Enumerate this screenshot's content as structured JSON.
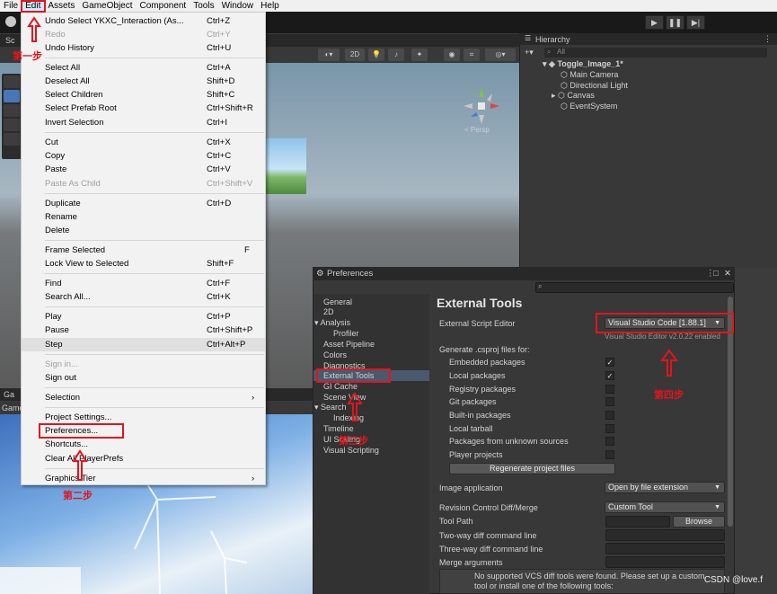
{
  "menubar": {
    "items": [
      "File",
      "Edit",
      "Assets",
      "GameObject",
      "Component",
      "Tools",
      "Window",
      "Help"
    ]
  },
  "edit_menu": {
    "items": [
      {
        "label": "Undo Select YKXC_Interaction (As...",
        "shortcut": "Ctrl+Z"
      },
      {
        "label": "Redo",
        "shortcut": "Ctrl+Y",
        "disabled": true
      },
      {
        "label": "Undo History",
        "shortcut": "Ctrl+U"
      },
      {
        "label": "Select All",
        "shortcut": "Ctrl+A"
      },
      {
        "label": "Deselect All",
        "shortcut": "Shift+D"
      },
      {
        "label": "Select Children",
        "shortcut": "Shift+C"
      },
      {
        "label": "Select Prefab Root",
        "shortcut": "Ctrl+Shift+R"
      },
      {
        "label": "Invert Selection",
        "shortcut": "Ctrl+I"
      },
      {
        "label": "Cut",
        "shortcut": "Ctrl+X"
      },
      {
        "label": "Copy",
        "shortcut": "Ctrl+C"
      },
      {
        "label": "Paste",
        "shortcut": "Ctrl+V"
      },
      {
        "label": "Paste As Child",
        "shortcut": "Ctrl+Shift+V",
        "disabled": true
      },
      {
        "label": "Duplicate",
        "shortcut": "Ctrl+D"
      },
      {
        "label": "Rename",
        "shortcut": ""
      },
      {
        "label": "Delete",
        "shortcut": ""
      },
      {
        "label": "Frame Selected",
        "shortcut": "F"
      },
      {
        "label": "Lock View to Selected",
        "shortcut": "Shift+F"
      },
      {
        "label": "Find",
        "shortcut": "Ctrl+F"
      },
      {
        "label": "Search All...",
        "shortcut": "Ctrl+K"
      },
      {
        "label": "Play",
        "shortcut": "Ctrl+P"
      },
      {
        "label": "Pause",
        "shortcut": "Ctrl+Shift+P"
      },
      {
        "label": "Step",
        "shortcut": "Ctrl+Alt+P"
      },
      {
        "label": "Sign in...",
        "shortcut": "",
        "disabled": true
      },
      {
        "label": "Sign out",
        "shortcut": ""
      },
      {
        "label": "Selection",
        "shortcut": "›"
      },
      {
        "label": "Project Settings...",
        "shortcut": ""
      },
      {
        "label": "Preferences...",
        "shortcut": ""
      },
      {
        "label": "Shortcuts...",
        "shortcut": ""
      },
      {
        "label": "Clear All PlayerPrefs",
        "shortcut": ""
      },
      {
        "label": "Graphics Tier",
        "shortcut": "›"
      }
    ]
  },
  "hierarchy": {
    "tab": "Hierarchy",
    "search_placeholder": "All",
    "scene": "Toggle_Image_1*",
    "items": [
      "Main Camera",
      "Directional Light",
      "Canvas",
      "EventSystem"
    ]
  },
  "scene_view": {
    "tab": "Sc",
    "persp": "< Persp",
    "mode_2d": "2D"
  },
  "game_view": {
    "tab": "Ga",
    "tab2": "Game"
  },
  "preferences": {
    "title": "Preferences",
    "left_items": [
      "General",
      "2D",
      "Analysis",
      "Profiler",
      "Asset Pipeline",
      "Colors",
      "Diagnostics",
      "External Tools",
      "GI Cache",
      "Scene View",
      "Search",
      "Indexing",
      "Timeline",
      "UI Scaling",
      "Visual Scripting"
    ],
    "heading": "External Tools",
    "script_editor_label": "External Script Editor",
    "script_editor_value": "Visual Studio Code [1.88.1]",
    "editor_version": "Visual Studio Editor v2.0.22 enabled",
    "csproj_label": "Generate .csproj files for:",
    "csproj_options": [
      {
        "label": "Embedded packages",
        "checked": true
      },
      {
        "label": "Local packages",
        "checked": true
      },
      {
        "label": "Registry packages",
        "checked": false
      },
      {
        "label": "Git packages",
        "checked": false
      },
      {
        "label": "Built-in packages",
        "checked": false
      },
      {
        "label": "Local tarball",
        "checked": false
      },
      {
        "label": "Packages from unknown sources",
        "checked": false
      },
      {
        "label": "Player projects",
        "checked": false
      }
    ],
    "regenerate": "Regenerate project files",
    "image_app_label": "Image application",
    "image_app_value": "Open by file extension",
    "rev_label": "Revision Control Diff/Merge",
    "rev_value": "Custom Tool",
    "tool_path_label": "Tool Path",
    "browse": "Browse",
    "two_way": "Two-way diff command line",
    "three_way": "Three-way diff command line",
    "merge_args": "Merge arguments",
    "vcs_msg1": "No supported VCS diff tools were found. Please set up a custom",
    "vcs_msg2": "tool or install one of the following tools:"
  },
  "annotations": {
    "step1": "第一步",
    "step2": "第二步",
    "step3": "第三步",
    "step4": "第四步",
    "color": "#e3141b"
  },
  "watermark": "CSDN @love.f"
}
